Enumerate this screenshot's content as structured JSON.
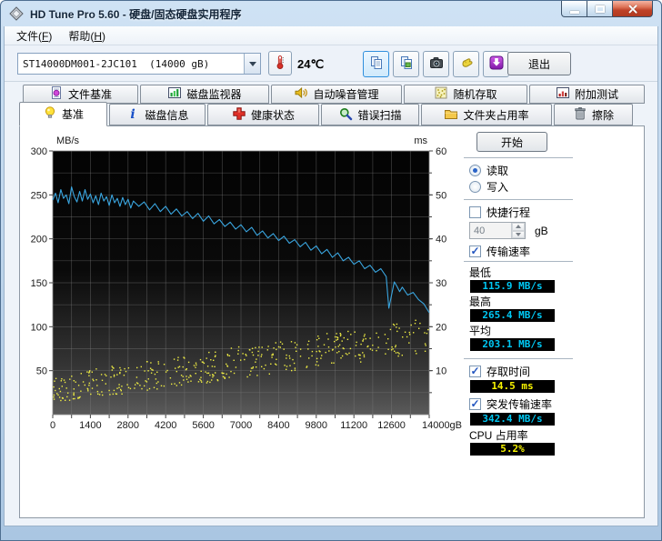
{
  "window": {
    "title": "HD Tune Pro 5.60 - 硬盘/固态硬盘实用程序"
  },
  "menu": {
    "items": [
      "文件(F)",
      "帮助(H)"
    ]
  },
  "toolbar": {
    "drive": "ST14000DM001-2JC101  (14000 gB)",
    "temperature": "24℃",
    "exit": "退出",
    "buttons": [
      {
        "name": "copy",
        "icon": "copy-icon",
        "selected": true
      },
      {
        "name": "copy-image",
        "icon": "copy-image-icon",
        "selected": false
      },
      {
        "name": "screenshot",
        "icon": "camera-icon",
        "selected": false
      },
      {
        "name": "hand",
        "icon": "hand-icon",
        "selected": false
      },
      {
        "name": "download",
        "icon": "download-icon",
        "selected": false
      }
    ]
  },
  "tabs_top": [
    {
      "label": "文件基准",
      "icon": "doc-bulb"
    },
    {
      "label": "磁盘监视器",
      "icon": "bar-monitor"
    },
    {
      "label": "自动噪音管理",
      "icon": "speaker"
    },
    {
      "label": "随机存取",
      "icon": "scatter"
    },
    {
      "label": "附加测试",
      "icon": "extra-chart"
    }
  ],
  "tabs_bottom": [
    {
      "label": "基准",
      "icon": "bulb",
      "active": true
    },
    {
      "label": "磁盘信息",
      "icon": "info",
      "active": false
    },
    {
      "label": "健康状态",
      "icon": "red-cross",
      "active": false
    },
    {
      "label": "错误扫描",
      "icon": "magnifier",
      "active": false
    },
    {
      "label": "文件夹占用率",
      "icon": "folder",
      "active": false
    },
    {
      "label": "擦除",
      "icon": "trash",
      "active": false
    }
  ],
  "panel": {
    "start": "开始",
    "read": "读取",
    "write": "写入",
    "short_stroke": "快捷行程",
    "short_stroke_value": "40",
    "short_stroke_unit": "gB",
    "transfer": "传输速率",
    "min_label": "最低",
    "min_value": "115.9 MB/s",
    "max_label": "最高",
    "max_value": "265.4 MB/s",
    "avg_label": "平均",
    "avg_value": "203.1 MB/s",
    "access_label": "存取时间",
    "access_value": "14.5 ms",
    "burst_label": "突发传输速率",
    "burst_value": "342.4 MB/s",
    "cpu_label": "CPU 占用率",
    "cpu_value": "5.2%"
  },
  "chart_data": {
    "type": "line",
    "title": "HD Tune read benchmark: transfer rate (line) and access time (scatter)",
    "x_axis": {
      "min": 0,
      "max": 14000,
      "grid_step": 700,
      "label_step": 1400,
      "labels": [
        "0",
        "1400",
        "2800",
        "4200",
        "5600",
        "7000",
        "8400",
        "9800",
        "11200",
        "12600",
        "14000gB"
      ]
    },
    "left_axis": {
      "label": "MB/s",
      "min": 0,
      "max": 300,
      "grid_step": 25,
      "tick_labels": [
        300,
        250,
        200,
        150,
        100,
        50
      ]
    },
    "right_axis": {
      "label": "ms",
      "min": 0,
      "max": 60,
      "tick_step": 10,
      "tick_labels": [
        60,
        50,
        40,
        30,
        20,
        10
      ]
    },
    "grid": true,
    "background": "black-gradient",
    "series": [
      {
        "name": "transfer-rate",
        "axis": "left",
        "unit": "MB/s",
        "color": "#3aa6e0",
        "points": [
          [
            0,
            244
          ],
          [
            100,
            252
          ],
          [
            200,
            241
          ],
          [
            300,
            256
          ],
          [
            400,
            246
          ],
          [
            500,
            250
          ],
          [
            600,
            240
          ],
          [
            700,
            259
          ],
          [
            800,
            248
          ],
          [
            900,
            242
          ],
          [
            1000,
            254
          ],
          [
            1100,
            243
          ],
          [
            1200,
            256
          ],
          [
            1300,
            245
          ],
          [
            1400,
            251
          ],
          [
            1500,
            241
          ],
          [
            1600,
            249
          ],
          [
            1700,
            239
          ],
          [
            1800,
            252
          ],
          [
            1900,
            243
          ],
          [
            2000,
            248
          ],
          [
            2100,
            238
          ],
          [
            2200,
            250
          ],
          [
            2300,
            241
          ],
          [
            2400,
            246
          ],
          [
            2500,
            237
          ],
          [
            2600,
            247
          ],
          [
            2700,
            239
          ],
          [
            2800,
            245
          ],
          [
            2900,
            235
          ],
          [
            3000,
            243
          ],
          [
            3200,
            237
          ],
          [
            3400,
            242
          ],
          [
            3600,
            233
          ],
          [
            3800,
            240
          ],
          [
            4000,
            231
          ],
          [
            4200,
            237
          ],
          [
            4400,
            228
          ],
          [
            4600,
            234
          ],
          [
            4800,
            226
          ],
          [
            5000,
            231
          ],
          [
            5200,
            223
          ],
          [
            5400,
            229
          ],
          [
            5600,
            220
          ],
          [
            5800,
            226
          ],
          [
            6000,
            217
          ],
          [
            6200,
            222
          ],
          [
            6400,
            214
          ],
          [
            6600,
            219
          ],
          [
            6800,
            211
          ],
          [
            7000,
            216
          ],
          [
            7200,
            208
          ],
          [
            7400,
            213
          ],
          [
            7600,
            204
          ],
          [
            7800,
            209
          ],
          [
            8000,
            201
          ],
          [
            8200,
            206
          ],
          [
            8400,
            198
          ],
          [
            8600,
            203
          ],
          [
            8800,
            195
          ],
          [
            9000,
            199
          ],
          [
            9200,
            191
          ],
          [
            9400,
            196
          ],
          [
            9600,
            187
          ],
          [
            9800,
            192
          ],
          [
            10000,
            183
          ],
          [
            10200,
            188
          ],
          [
            10400,
            179
          ],
          [
            10600,
            184
          ],
          [
            10800,
            175
          ],
          [
            11000,
            179
          ],
          [
            11200,
            171
          ],
          [
            11400,
            175
          ],
          [
            11600,
            166
          ],
          [
            11800,
            170
          ],
          [
            12000,
            162
          ],
          [
            12200,
            166
          ],
          [
            12400,
            157
          ],
          [
            12500,
            121
          ],
          [
            12600,
            136
          ],
          [
            12700,
            151
          ],
          [
            12800,
            146
          ],
          [
            12900,
            140
          ],
          [
            13000,
            145
          ],
          [
            13200,
            136
          ],
          [
            13400,
            139
          ],
          [
            13600,
            131
          ],
          [
            13800,
            126
          ],
          [
            13900,
            121
          ],
          [
            14000,
            116
          ]
        ]
      },
      {
        "name": "access-time",
        "axis": "right",
        "unit": "ms",
        "color": "#f0ee44",
        "style": "scatter",
        "count": 470,
        "seed": 42,
        "band_ms_at_start": [
          2.5,
          9
        ],
        "band_ms_at_end": [
          14,
          22
        ]
      }
    ]
  }
}
